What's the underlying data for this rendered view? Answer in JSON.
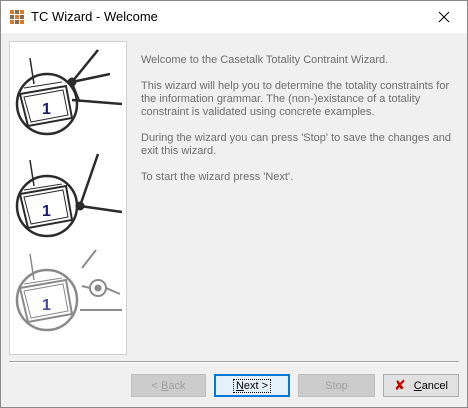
{
  "window": {
    "title": "TC Wizard - Welcome",
    "app_icon": "grid-app-icon",
    "close_icon": "close-icon"
  },
  "content": {
    "paragraphs": [
      "Welcome to the Casetalk Totality Contraint Wizard.",
      "This wizard will help you to determine the totality constraints for the information grammar. The (non-)existance of a totality constraint is validated using concrete examples.",
      "During the wizard you can press 'Stop' to save the changes and exit this wizard.",
      "To start the wizard press 'Next'."
    ],
    "illustration_numbers": [
      "1",
      "1",
      "1"
    ]
  },
  "buttons": {
    "back": {
      "prefix": "< ",
      "underline": "B",
      "rest": "ack",
      "enabled": false
    },
    "next": {
      "underline": "N",
      "rest": "ext >",
      "enabled": true
    },
    "stop": {
      "label": "Stop",
      "enabled": false
    },
    "cancel": {
      "underline": "C",
      "rest": "ancel",
      "icon": "red-x-icon",
      "enabled": true
    }
  },
  "colors": {
    "body_text": "#6d6d6d",
    "default_button_border": "#0078d7",
    "cancel_icon": "#c00000"
  }
}
